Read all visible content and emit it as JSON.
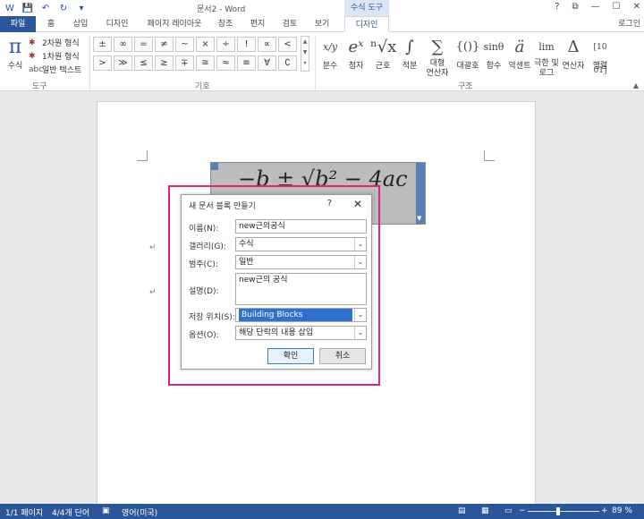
{
  "window": {
    "doc_title": "문서2 - Word",
    "context_tab_group": "수식 도구",
    "controls": [
      "?",
      "⧉",
      "—",
      "☐",
      "✕"
    ],
    "qat": [
      "W",
      "💾",
      "↶",
      "↻",
      "▾"
    ]
  },
  "tabs": {
    "file": "파일",
    "home": "홈",
    "insert": "삽입",
    "design1": "디자인",
    "layout": "페이지 레이아웃",
    "references": "참조",
    "mailings": "편지",
    "review": "검토",
    "view": "보기",
    "design_active": "디자인",
    "login": "로그인"
  },
  "ribbon": {
    "tools": {
      "equation": "수식",
      "pi": "π",
      "row1": "2차원 형식",
      "row2": "1차원 형식",
      "row3": "일반 텍스트",
      "label": "도구"
    },
    "symbols": {
      "label": "기호",
      "items": [
        "±",
        "∞",
        "=",
        "≠",
        "~",
        "×",
        "÷",
        "!",
        "∝",
        "<",
        "≪",
        ">",
        "≫",
        "≤",
        "≥",
        "∓",
        "≅",
        "≈",
        "≡",
        "∀",
        "∁",
        "∂"
      ]
    },
    "structures": {
      "label": "구조",
      "items": [
        {
          "icon": "x/y",
          "label": "분수"
        },
        {
          "icon": "eˣ",
          "label": "첨자"
        },
        {
          "icon": "ⁿ√x",
          "label": "근호"
        },
        {
          "icon": "∫",
          "label": "적분"
        },
        {
          "icon": "∑",
          "label": "대형 연산자"
        },
        {
          "icon": "{()}",
          "label": "대괄호"
        },
        {
          "icon": "sinθ",
          "label": "함수"
        },
        {
          "icon": "ä",
          "label": "악센트"
        },
        {
          "icon": "lim",
          "label": "극한 및 로그"
        },
        {
          "icon": "Δ",
          "label": "연산자"
        },
        {
          "icon": "[10 01]",
          "label": "행렬"
        }
      ]
    }
  },
  "document": {
    "equation": "−b ± √b² − 4ac"
  },
  "dialog": {
    "title": "새 문서 블록 만들기",
    "help": "?",
    "close": "✕",
    "name_label": "이름(N):",
    "name_value": "new근의공식",
    "gallery_label": "갤러리(G):",
    "gallery_value": "수식",
    "category_label": "범주(C):",
    "category_value": "일반",
    "description_label": "설명(D):",
    "description_value": "new근의 공식",
    "save_in_label": "저장 위치(S):",
    "save_in_value": "Building Blocks",
    "options_label": "옵션(O):",
    "options_value": "해당 단락의 내용 삽입",
    "ok": "확인",
    "cancel": "취소"
  },
  "statusbar": {
    "page": "1/1 페이지",
    "words": "4/4개 단어",
    "language": "영어(미국)",
    "zoom": "89 %",
    "zoom_minus": "−",
    "zoom_plus": "+"
  },
  "colors": {
    "word_blue": "#2b579a",
    "highlight": "#e0237b"
  }
}
